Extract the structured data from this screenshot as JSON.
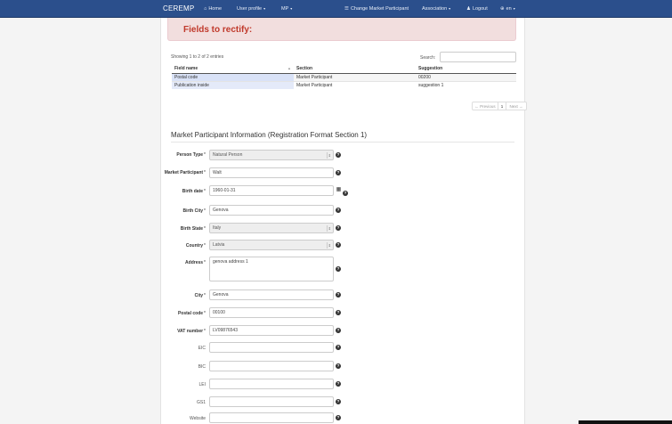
{
  "navbar": {
    "brand": "CEREMP",
    "home": "Home",
    "user_profile": "User profile",
    "mp": "MP",
    "change_mp": "Change Market Participant",
    "association": "Association",
    "logout": "Logout",
    "language": "en"
  },
  "rectify": {
    "title": "Fields to rectify:",
    "entries_info": "Showing 1 to 2 of 2 entries",
    "search_label": "Search:",
    "search_value": "",
    "columns": [
      "Field name",
      "Section",
      "Suggestion"
    ],
    "rows": [
      [
        "Postal code",
        "Market Participant",
        "00200"
      ],
      [
        "Publication inside",
        "Market Participant",
        "suggestion 1"
      ]
    ],
    "pager": {
      "previous": "← Previous",
      "page": "1",
      "next": "Next →"
    }
  },
  "section": {
    "title": "Market Participant Information (Registration Format Section 1)"
  },
  "form": {
    "person_type": {
      "label": "Person Type",
      "value": "Natural Person"
    },
    "market_participant": {
      "label": "Market Participant",
      "value": "Walt"
    },
    "birth_date": {
      "label": "Birth date",
      "value": "1960-01-31"
    },
    "birth_city": {
      "label": "Birth City",
      "value": "Genova"
    },
    "birth_state": {
      "label": "Birth State",
      "value": "Italy"
    },
    "country": {
      "label": "Country",
      "value": "Latvia"
    },
    "address": {
      "label": "Address",
      "value": "genova address 1"
    },
    "city": {
      "label": "City",
      "value": "Genova"
    },
    "postal_code": {
      "label": "Postal code",
      "value": "00100"
    },
    "vat_number": {
      "label": "VAT number",
      "value": "LV09876543"
    },
    "eic": {
      "label": "EIC",
      "value": ""
    },
    "bic": {
      "label": "BIC",
      "value": ""
    },
    "lei": {
      "label": "LEI",
      "value": ""
    },
    "gs1": {
      "label": "GS1",
      "value": ""
    },
    "website": {
      "label": "Website",
      "value": ""
    },
    "required_mark": "*",
    "help_glyph": "?"
  },
  "icons": {
    "home": "home-icon",
    "user": "user-icon",
    "globe": "globe-icon",
    "list": "list-icon",
    "calendar": "calendar-icon",
    "help": "question-circle-icon"
  },
  "colors": {
    "navbar": "#2b4f8c",
    "alert_bg": "#f2dede",
    "alert_text": "#c0392b",
    "row_highlight": "#d9e2f7"
  }
}
